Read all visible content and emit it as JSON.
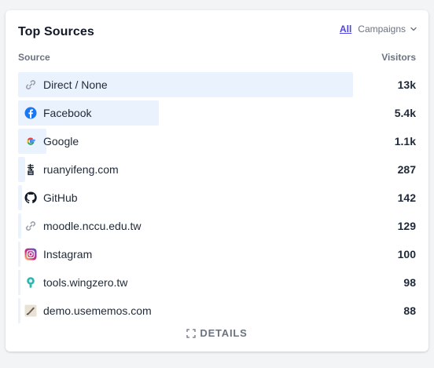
{
  "widget": {
    "title": "Top Sources",
    "tab_all": "All",
    "tab_campaigns": "Campaigns",
    "col_source": "Source",
    "col_visitors": "Visitors",
    "details_label": "DETAILS",
    "bar_color": "#eaf2fe",
    "accent_color": "#4f46e5"
  },
  "rows": [
    {
      "label": "Direct / None",
      "value": "13k",
      "share": 1.0,
      "icon": "link-icon"
    },
    {
      "label": "Facebook",
      "value": "5.4k",
      "share": 0.42,
      "icon": "facebook-icon"
    },
    {
      "label": "Google",
      "value": "1.1k",
      "share": 0.085,
      "icon": "google-icon"
    },
    {
      "label": "ruanyifeng.com",
      "value": "287",
      "share": 0.022,
      "icon": "ruanyifeng-icon"
    },
    {
      "label": "GitHub",
      "value": "142",
      "share": 0.011,
      "icon": "github-icon"
    },
    {
      "label": "moodle.nccu.edu.tw",
      "value": "129",
      "share": 0.01,
      "icon": "link-icon"
    },
    {
      "label": "Instagram",
      "value": "100",
      "share": 0.008,
      "icon": "instagram-icon"
    },
    {
      "label": "tools.wingzero.tw",
      "value": "98",
      "share": 0.0075,
      "icon": "wingzero-icon"
    },
    {
      "label": "demo.usememos.com",
      "value": "88",
      "share": 0.007,
      "icon": "usememos-icon"
    }
  ]
}
